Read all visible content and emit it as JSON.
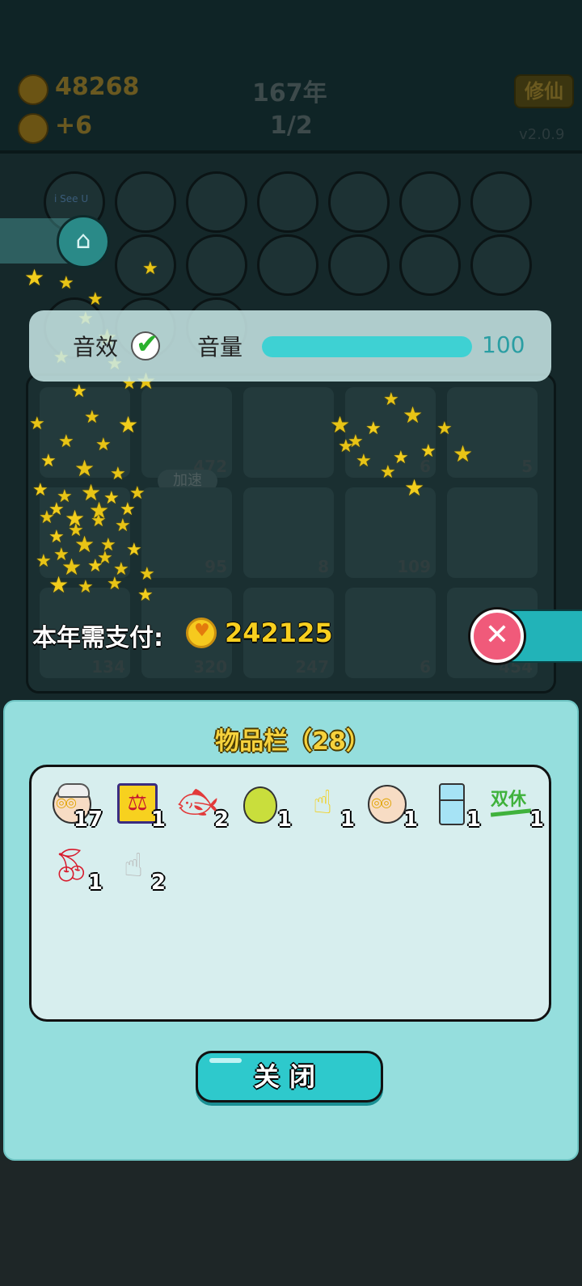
{
  "hud": {
    "coins": "48268",
    "income": "+6",
    "year": "167年",
    "page": "1/2",
    "xiuxian_label": "修仙",
    "version": "v2.0.9"
  },
  "background": {
    "speedup_label": "加速",
    "see_u_label": "i See U",
    "card_numbers": [
      "472",
      "6",
      "5",
      "95",
      "8",
      "109",
      "134",
      "320",
      "247",
      "6",
      "454"
    ]
  },
  "sound": {
    "sfx_label": "音效",
    "sfx_enabled": true,
    "volume_label": "音量",
    "volume_value": "100",
    "volume_fraction": 1.0
  },
  "payment": {
    "label": "本年需支付:",
    "amount": "242125"
  },
  "inventory": {
    "title": "物品栏（28）",
    "items": [
      {
        "icon": "old-man-face-icon",
        "count": "17"
      },
      {
        "icon": "scales-icon",
        "count": "1"
      },
      {
        "icon": "koi-fish-icon",
        "count": "2"
      },
      {
        "icon": "pear-icon",
        "count": "1"
      },
      {
        "icon": "yellow-pointing-hand-icon",
        "count": "1"
      },
      {
        "icon": "bald-man-glasses-icon",
        "count": "1"
      },
      {
        "icon": "fridge-icon",
        "count": "1"
      },
      {
        "icon": "shuangxiu-sign-icon",
        "count": "1"
      },
      {
        "icon": "cherry-icon",
        "count": "1"
      },
      {
        "icon": "grey-pointing-hand-icon",
        "count": "2"
      }
    ],
    "shuangxiu_text": "双休",
    "close_label": "关闭"
  }
}
